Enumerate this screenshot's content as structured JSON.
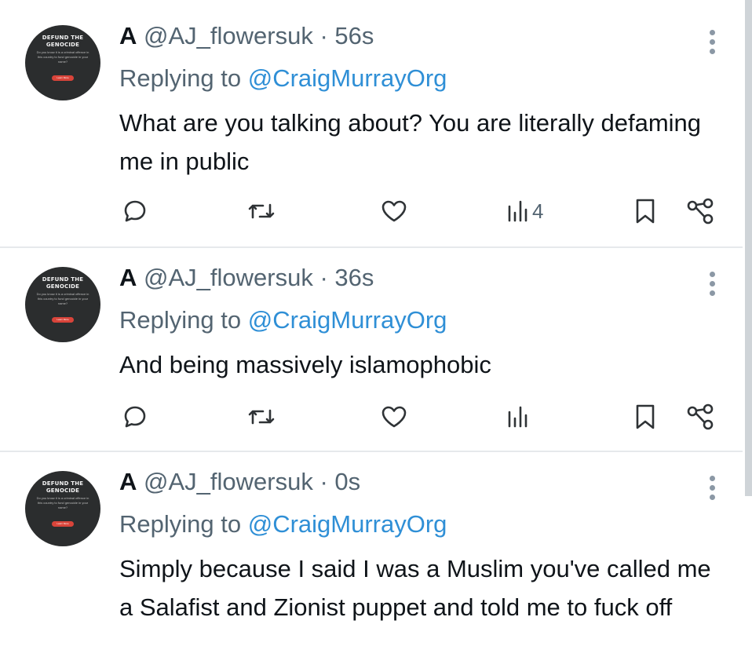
{
  "avatar": {
    "title": "DEFUND THE GENOCIDE",
    "sub": "Do you know it is a criminal offence in this country to fund genocide in your name?",
    "button": "Learn More"
  },
  "tweets": [
    {
      "name": "A",
      "handle": "@AJ_flowersuk",
      "separator": "·",
      "time": "56s",
      "replying_prefix": "Replying to",
      "replying_to": "@CraigMurrayOrg",
      "text": "What are you talking about? You are literally defaming me in public",
      "views": "4"
    },
    {
      "name": "A",
      "handle": "@AJ_flowersuk",
      "separator": "·",
      "time": "36s",
      "replying_prefix": "Replying to",
      "replying_to": "@CraigMurrayOrg",
      "text": "And being massively islamophobic",
      "views": ""
    },
    {
      "name": "A",
      "handle": "@AJ_flowersuk",
      "separator": "·",
      "time": "0s",
      "replying_prefix": "Replying to",
      "replying_to": "@CraigMurrayOrg",
      "text": "Simply because I said I was a Muslim you've called me a Salafist and Zionist puppet and told me to fuck off",
      "views": ""
    }
  ],
  "colors": {
    "text": "#0f1419",
    "secondary": "#536471",
    "link": "#2f8fd6",
    "divider": "#e6e9ec"
  },
  "icons": [
    "reply-icon",
    "retweet-icon",
    "like-icon",
    "views-icon",
    "bookmark-icon",
    "share-icon",
    "more-icon"
  ]
}
